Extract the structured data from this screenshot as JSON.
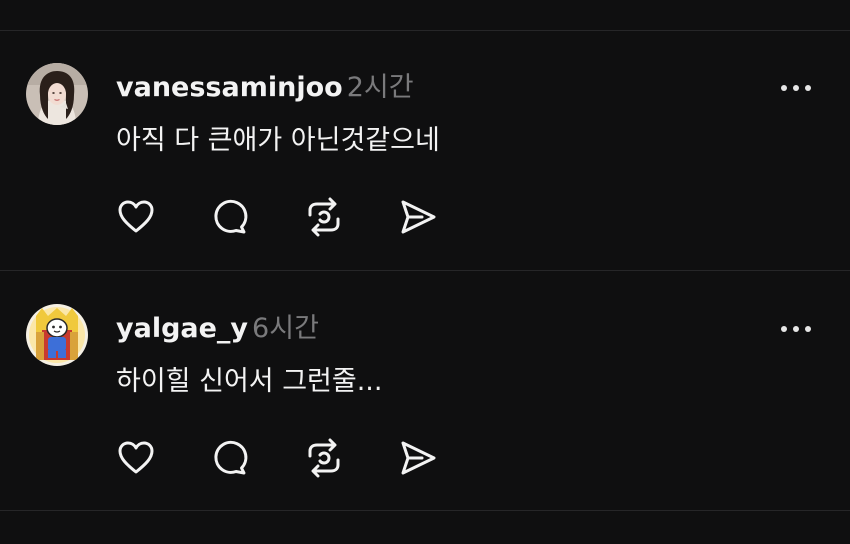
{
  "posts": [
    {
      "username": "vanessaminjoo",
      "time": "2시간",
      "text": "아직 다 큰애가 아닌것같으네",
      "avatar_icon": "portrait-photo"
    },
    {
      "username": "yalgae_y",
      "time": "6시간",
      "text": "하이힐 신어서 그런줄...",
      "avatar_icon": "cartoon-character-on-throne"
    }
  ],
  "actions": [
    "heart-icon",
    "comment-icon",
    "repost-icon",
    "share-icon"
  ],
  "more_icon": "more-icon",
  "colors": {
    "background": "#0f0f10",
    "text": "#f3f3f3",
    "secondary": "#7a7a7c",
    "divider": "#262628"
  }
}
